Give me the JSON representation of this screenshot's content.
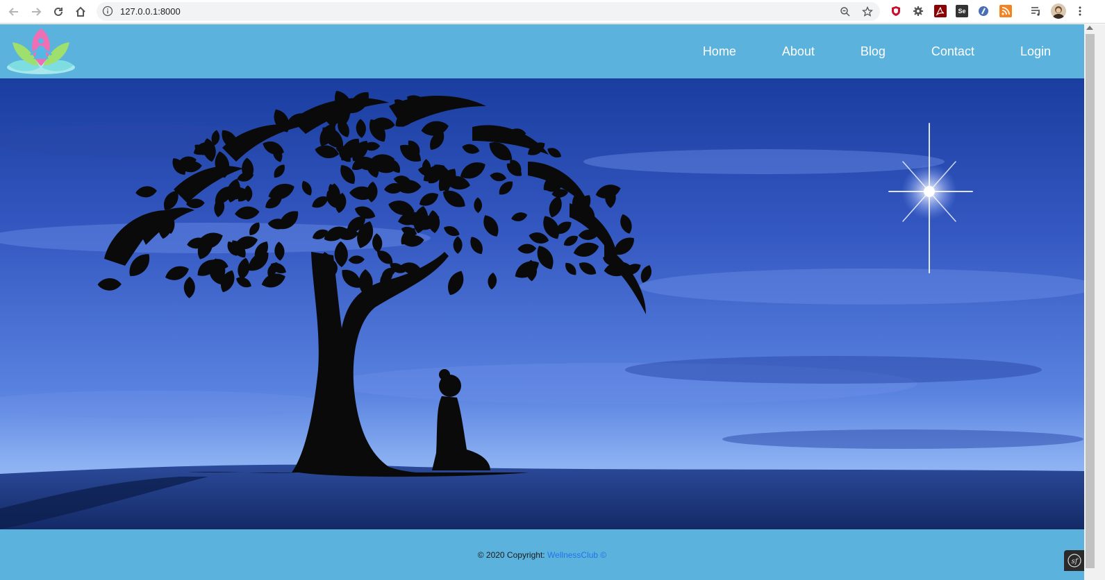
{
  "browser": {
    "url": "127.0.0.1:8000",
    "toolbar_icons": [
      "back-icon",
      "forward-icon",
      "reload-icon",
      "home-icon",
      "info-icon",
      "zoom-icon",
      "bookmark-star-icon"
    ],
    "extensions": [
      "ublock-icon",
      "gear-extension-icon",
      "acrobat-icon",
      "selenium-icon",
      "shield-extension-icon",
      "rss-icon",
      "media-queue-icon",
      "profile-avatar",
      "kebab-menu-icon"
    ],
    "selenium_label": "Se"
  },
  "site": {
    "colors": {
      "header_bg": "#5ab2dd",
      "footer_bg": "#5ab2dd",
      "link": "#1f75e8",
      "sky": "#3f63c8"
    },
    "logo": "lotus-logo",
    "nav": {
      "home": "Home",
      "about": "About",
      "blog": "Blog",
      "contact": "Contact",
      "login": "Login"
    },
    "hero": {
      "image": "meditation-under-tree-night-illustration"
    },
    "footer": {
      "copyright_prefix": "© 2020 Copyright: ",
      "brand": "WellnessClub ©"
    },
    "debug_toolbar_label": "sf"
  }
}
